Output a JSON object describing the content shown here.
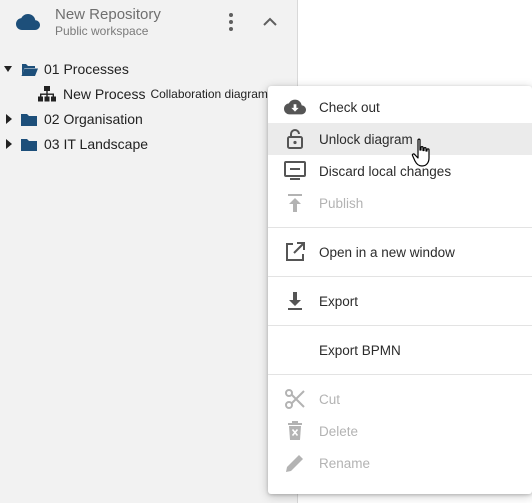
{
  "repository": {
    "title": "New Repository",
    "subtitle": "Public workspace",
    "icon": "cloud-icon",
    "accent_color": "#1d4f7a"
  },
  "tree": [
    {
      "label": "01 Processes",
      "expanded": true,
      "icon": "folder-open-icon"
    },
    {
      "label": "New Process",
      "sublabel": "Collaboration diagram ...",
      "icon": "hierarchy-icon"
    },
    {
      "label": "02 Organisation",
      "expanded": false,
      "icon": "folder-icon"
    },
    {
      "label": "03 IT Landscape",
      "expanded": false,
      "icon": "folder-icon"
    }
  ],
  "context_menu": {
    "items": [
      {
        "label": "Check out",
        "icon": "cloud-download-icon",
        "enabled": true
      },
      {
        "label": "Unlock diagram",
        "icon": "unlock-icon",
        "enabled": true,
        "hovered": true
      },
      {
        "label": "Discard local changes",
        "icon": "monitor-minus-icon",
        "enabled": true
      },
      {
        "label": "Publish",
        "icon": "publish-icon",
        "enabled": false
      },
      {
        "label": "Open in a new window",
        "icon": "open-external-icon",
        "enabled": true
      },
      {
        "label": "Export",
        "icon": "download-icon",
        "enabled": true
      },
      {
        "label": "Export BPMN",
        "icon": "",
        "enabled": true
      },
      {
        "label": "Cut",
        "icon": "scissors-icon",
        "enabled": false
      },
      {
        "label": "Delete",
        "icon": "trash-icon",
        "enabled": false
      },
      {
        "label": "Rename",
        "icon": "pencil-icon",
        "enabled": false
      }
    ]
  },
  "colors": {
    "folder": "#1d4f7a",
    "menu_icon": "#555555",
    "disabled": "#b3b3b3",
    "hover_bg": "#ebebeb"
  }
}
